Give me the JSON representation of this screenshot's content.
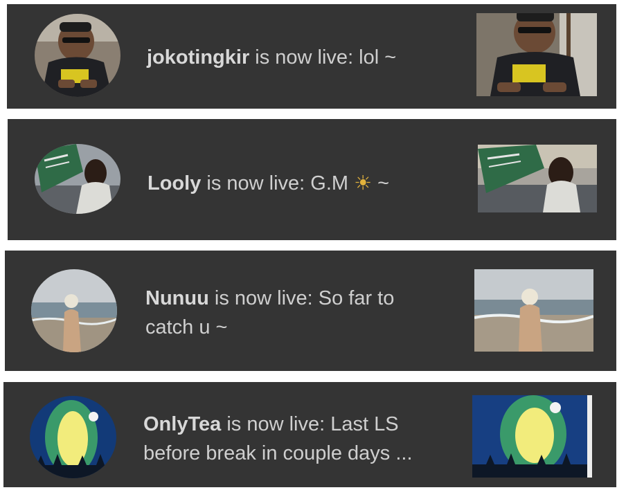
{
  "notifications": [
    {
      "username": "jokotingkir",
      "text": " is now live: lol ~",
      "emoji": "",
      "suffix": "",
      "avatar_icon": "person-avatar-icon"
    },
    {
      "username": "Looly",
      "text": " is now live: G.M ",
      "emoji": "☀",
      "suffix": " ~",
      "avatar_icon": "flag-avatar-icon"
    },
    {
      "username": "Nunuu",
      "text": " is now live: So far to catch u ~",
      "emoji": "",
      "suffix": "",
      "avatar_icon": "beach-flowers-avatar-icon"
    },
    {
      "username": "OnlyTea",
      "text": " is now live: Last LS before break in couple days ...",
      "emoji": "",
      "suffix": "",
      "avatar_icon": "galaxy-painting-avatar-icon"
    }
  ],
  "colors": {
    "card_bg": "#343434",
    "text": "#cfcfcf",
    "username": "#d8d8d8"
  }
}
